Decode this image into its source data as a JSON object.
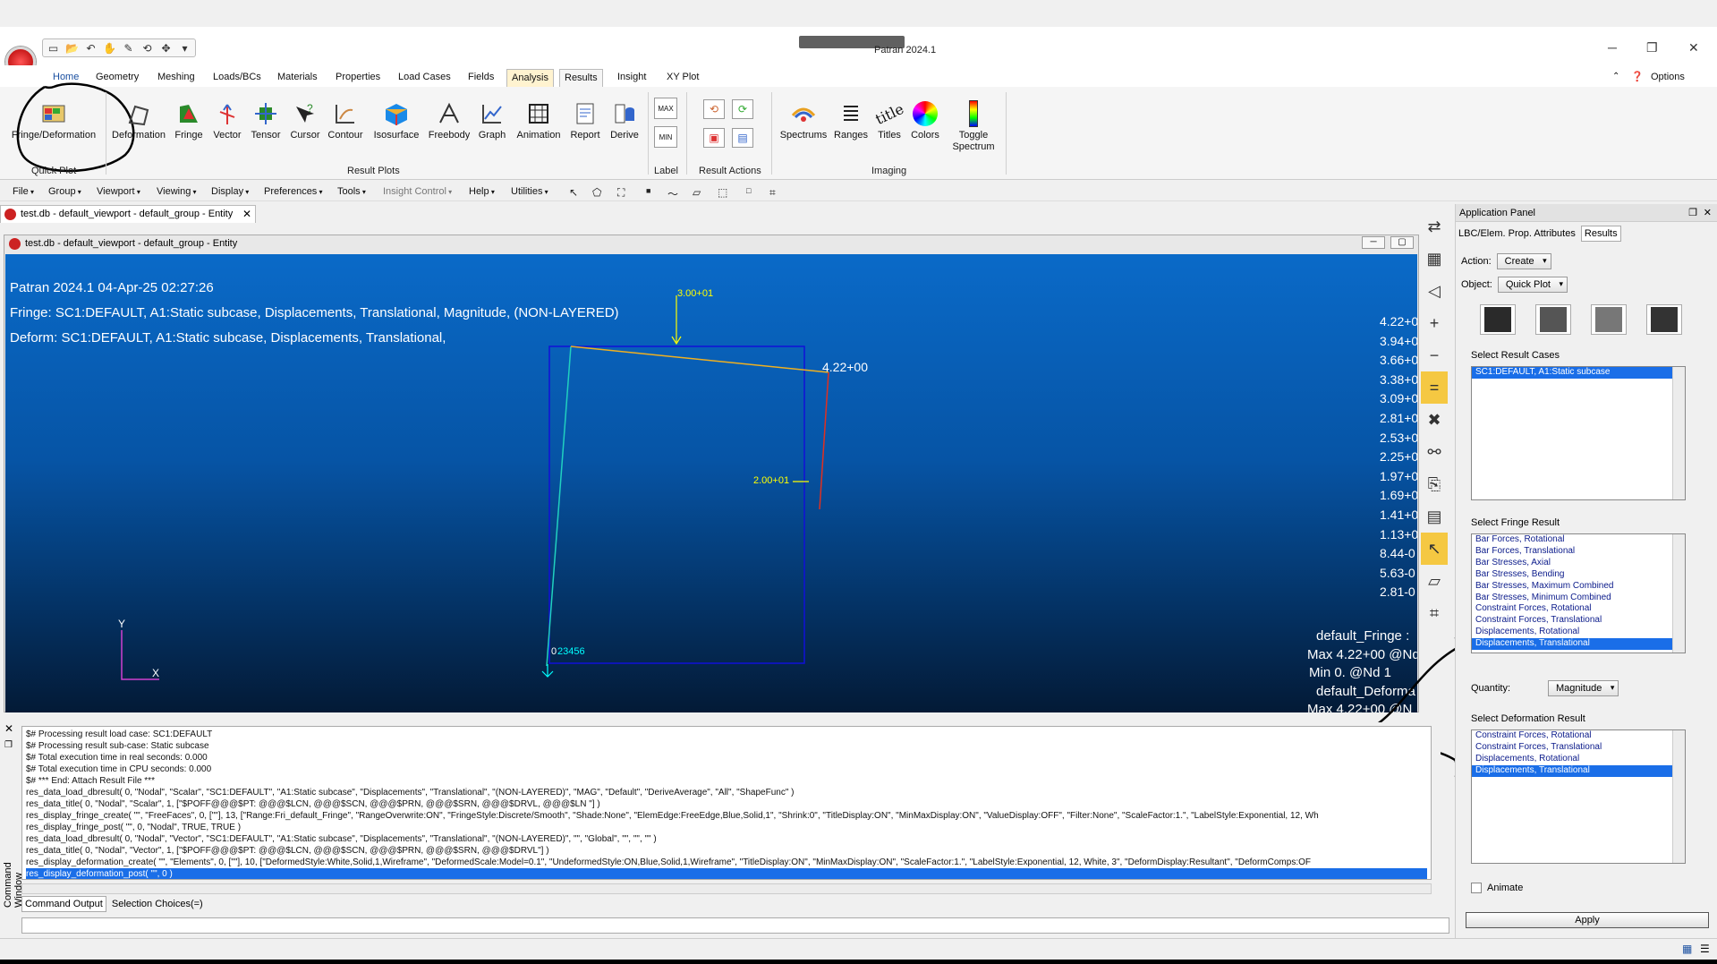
{
  "window": {
    "title": "Patran 2024.1",
    "controls": [
      "─",
      "❐",
      "✕"
    ]
  },
  "quick_access": [
    "new-doc-icon",
    "open-folder-icon",
    "undo-icon",
    "pan-hand-icon",
    "pick-icon",
    "rotate-icon",
    "move-icon",
    "more-icon"
  ],
  "ribbon_tabs": [
    {
      "label": "Home",
      "active": false
    },
    {
      "label": "Geometry",
      "active": false
    },
    {
      "label": "Meshing",
      "active": false
    },
    {
      "label": "Loads/BCs",
      "active": false
    },
    {
      "label": "Materials",
      "active": false
    },
    {
      "label": "Properties",
      "active": false
    },
    {
      "label": "Load Cases",
      "active": false
    },
    {
      "label": "Fields",
      "active": false
    },
    {
      "label": "Analysis",
      "active": true
    },
    {
      "label": "Results",
      "active": true
    },
    {
      "label": "Insight",
      "active": false
    },
    {
      "label": "XY Plot",
      "active": false
    }
  ],
  "ribbon_right": {
    "options": "Options"
  },
  "ribbon_groups": {
    "quick_plot": {
      "label": "Quick Plot",
      "buttons": [
        "Fringe/Deformation"
      ]
    },
    "result_plots": {
      "label": "Result Plots",
      "buttons": [
        "Deformation",
        "Fringe",
        "Vector",
        "Tensor",
        "Cursor",
        "Contour",
        "Isosurface",
        "Freebody",
        "Graph",
        "Animation",
        "Report",
        "Derive"
      ]
    },
    "label": {
      "label": "Label",
      "buttons": [
        "MAX",
        "MIN"
      ]
    },
    "result_actions": {
      "label": "Result Actions"
    },
    "imaging": {
      "label": "Imaging",
      "buttons": [
        "Spectrums",
        "Ranges",
        "Titles",
        "Colors",
        "Toggle Spectrum"
      ]
    }
  },
  "menubar": [
    {
      "label": "File",
      "disabled": false
    },
    {
      "label": "Group",
      "disabled": false
    },
    {
      "label": "Viewport",
      "disabled": false
    },
    {
      "label": "Viewing",
      "disabled": false
    },
    {
      "label": "Display",
      "disabled": false
    },
    {
      "label": "Preferences",
      "disabled": false
    },
    {
      "label": "Tools",
      "disabled": false
    },
    {
      "label": "Insight Control",
      "disabled": true
    },
    {
      "label": "Help",
      "disabled": false
    },
    {
      "label": "Utilities",
      "disabled": false
    }
  ],
  "doc_tab": {
    "label": "test.db - default_viewport - default_group - Entity"
  },
  "viewport": {
    "title": "test.db - default_viewport - default_group - Entity",
    "header_lines": [
      "Patran 2024.1 04-Apr-25 02:27:26",
      "Fringe: SC1:DEFAULT, A1:Static subcase, Displacements, Translational, Magnitude, (NON-LAYERED)",
      "Deform: SC1:DEFAULT, A1:Static subcase, Displacements, Translational,"
    ],
    "load_top": "3.00+01",
    "load_side": "2.00+01",
    "max_label": "4.22+00",
    "node_label_prefix": "0",
    "node_label": "23456",
    "axis_y": "Y",
    "axis_x": "X",
    "spectrum_values": [
      "4.22+0",
      "3.94+0",
      "3.66+0",
      "3.38+0",
      "3.09+0",
      "2.81+0",
      "2.53+0",
      "2.25+0",
      "1.97+0",
      "1.69+0",
      "1.41+0",
      "1.13+0",
      "8.44-0",
      "5.63-0",
      "2.81-0"
    ],
    "fringe_info": [
      "default_Fringe :",
      "Max 4.22+00 @Nd",
      "Min  0. @Nd 1",
      "default_Deforma",
      "Max 4.22+00 @N"
    ],
    "colors": {
      "bg_top": "#0a6ac8",
      "bg_bottom": "#031a36",
      "label": "#ffff00",
      "node": "#00ffff"
    }
  },
  "app_panel": {
    "title": "Application Panel",
    "tabs": [
      {
        "label": "LBC/Elem. Prop. Attributes",
        "active": false
      },
      {
        "label": "Results",
        "active": true
      }
    ],
    "action_label": "Action:",
    "action_value": "Create",
    "object_label": "Object:",
    "object_value": "Quick Plot",
    "icon_buttons": [
      "quick-plot-icon",
      "fringe-plot-icon",
      "display-attr-icon",
      "animation-options-icon"
    ],
    "result_cases_label": "Select Result Cases",
    "result_cases": [
      {
        "label": "SC1:DEFAULT, A1:Static subcase",
        "selected": true
      }
    ],
    "fringe_label": "Select Fringe Result",
    "fringe_results": [
      {
        "label": "Bar Forces, Rotational",
        "selected": false
      },
      {
        "label": "Bar Forces, Translational",
        "selected": false
      },
      {
        "label": "Bar Stresses, Axial",
        "selected": false
      },
      {
        "label": "Bar Stresses, Bending",
        "selected": false
      },
      {
        "label": "Bar Stresses, Maximum Combined",
        "selected": false
      },
      {
        "label": "Bar Stresses, Minimum Combined",
        "selected": false
      },
      {
        "label": "Constraint Forces, Rotational",
        "selected": false
      },
      {
        "label": "Constraint Forces, Translational",
        "selected": false
      },
      {
        "label": "Displacements, Rotational",
        "selected": false
      },
      {
        "label": "Displacements, Translational",
        "selected": true
      }
    ],
    "quantity_label": "Quantity:",
    "quantity_value": "Magnitude",
    "deformation_label": "Select Deformation Result",
    "deformation_results": [
      {
        "label": "Constraint Forces, Rotational",
        "selected": false
      },
      {
        "label": "Constraint Forces, Translational",
        "selected": false
      },
      {
        "label": "Displacements, Rotational",
        "selected": false
      },
      {
        "label": "Displacements, Translational",
        "selected": true
      }
    ],
    "animate_label": "Animate",
    "apply_label": "Apply"
  },
  "command_window": {
    "side_label": "Command Window",
    "lines": [
      "$# Processing result load case: SC1:DEFAULT",
      "$# Processing result sub-case: Static subcase",
      "$# Total execution time in real seconds:      0.000",
      "$# Total execution time in CPU  seconds:      0.000",
      "$# *** End:   Attach Result File ***",
      "res_data_load_dbresult( 0, \"Nodal\", \"Scalar\", \"SC1:DEFAULT\", \"A1:Static subcase\", \"Displacements\", \"Translational\", \"(NON-LAYERED)\", \"MAG\", \"Default\", \"DeriveAverage\", \"All\", \"ShapeFunc\" )",
      "res_data_title( 0, \"Nodal\", \"Scalar\", 1, [\"$POFF@@@$PT: @@@$LCN, @@@$SCN, @@@$PRN, @@@$SRN, @@@$DRVL, @@@$LN \"] )",
      "res_display_fringe_create( \"\", \"FreeFaces\", 0, [\"\"], 13, [\"Range:Fri_default_Fringe\", \"RangeOverwrite:ON\", \"FringeStyle:Discrete/Smooth\", \"Shade:None\", \"ElemEdge:FreeEdge,Blue,Solid,1\", \"Shrink:0\", \"TitleDisplay:ON\", \"MinMaxDisplay:ON\", \"ValueDisplay:OFF\", \"Filter:None\", \"ScaleFactor:1.\", \"LabelStyle:Exponential, 12, Wh",
      "res_display_fringe_post( \"\", 0, \"Nodal\", TRUE, TRUE )",
      "res_data_load_dbresult( 0, \"Nodal\", \"Vector\", \"SC1:DEFAULT\", \"A1:Static subcase\", \"Displacements\", \"Translational\", \"(NON-LAYERED)\", \"\", \"Global\", \"\", \"\", \"\" )",
      "res_data_title( 0, \"Nodal\", \"Vector\", 1, [\"$POFF@@@$PT: @@@$LCN, @@@$SCN, @@@$PRN, @@@$SRN, @@@$DRVL\"] )",
      "res_display_deformation_create( \"\", \"Elements\", 0, [\"\"], 10, [\"DeformedStyle:White,Solid,1,Wireframe\", \"DeformedScale:Model=0.1\", \"UndeformedStyle:ON,Blue,Solid,1,Wireframe\", \"TitleDisplay:ON\", \"MinMaxDisplay:ON\", \"ScaleFactor:1.\", \"LabelStyle:Exponential, 12, White, 3\", \"DeformDisplay:Resultant\", \"DeformComps:OF"
    ],
    "selected_line": "res_display_deformation_post( \"\", 0 )",
    "tabs": [
      {
        "label": "Command Output",
        "active": true
      },
      {
        "label": "Selection Choices(=)",
        "active": false
      }
    ]
  }
}
